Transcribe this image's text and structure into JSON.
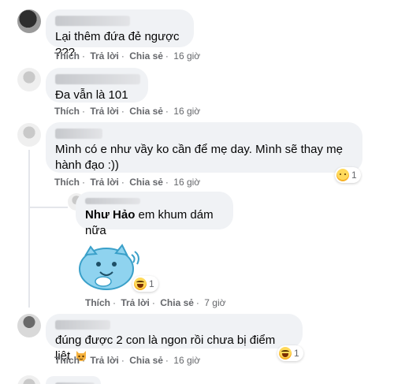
{
  "comments": [
    {
      "text": "Lại thêm đứa đẻ ngược ???",
      "actions": {
        "like": "Thích",
        "reply": "Trả lời",
        "share": "Chia sẻ",
        "time": "16 giờ"
      }
    },
    {
      "text": "Đa vẫn là 101",
      "actions": {
        "like": "Thích",
        "reply": "Trả lời",
        "share": "Chia sẻ",
        "time": "16 giờ"
      }
    },
    {
      "text": "Mình có e như vầy ko cần để mẹ day. Mình sẽ thay mẹ hành đạo :))",
      "reaction": {
        "icon": "sad-face-icon",
        "count": "1"
      },
      "actions": {
        "like": "Thích",
        "reply": "Trả lời",
        "share": "Chia sẻ",
        "time": "16 giờ"
      }
    },
    {
      "mention": "Như Hảo",
      "text": "em khum dám nữa",
      "sticker": "blue-cat-sticker",
      "reaction": {
        "icon": "laughing-face-icon",
        "count": "1"
      },
      "actions": {
        "like": "Thích",
        "reply": "Trả lời",
        "share": "Chia sẻ",
        "time": "7 giờ"
      }
    },
    {
      "text": "đúng được 2 con là ngon rồi chưa bị điểm liệt",
      "emoji": "cat-face-icon",
      "reaction": {
        "icon": "laughing-face-icon",
        "count": "1"
      },
      "actions": {
        "like": "Thích",
        "reply": "Trả lời",
        "share": "Chia sẻ",
        "time": "16 giờ"
      }
    }
  ],
  "colors": {
    "bubble": "#f0f2f5",
    "meta": "#65676b",
    "text": "#050505",
    "reaction": "#f7b125"
  }
}
